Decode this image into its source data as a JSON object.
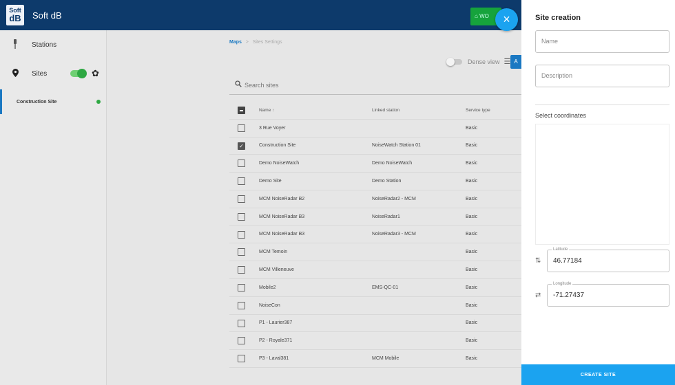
{
  "app": {
    "logo_top": "Soft",
    "logo_bottom": "dB",
    "title": "Soft dB",
    "green_button_label": "WO"
  },
  "sidebar": {
    "items": [
      {
        "label": "Stations",
        "icon": "radio-tower-icon"
      },
      {
        "label": "Sites",
        "icon": "map-pin-icon",
        "toggle_on": true
      }
    ],
    "site_list": [
      {
        "label": "Construction Site",
        "status_color": "#2ea843"
      }
    ]
  },
  "breadcrumb": {
    "root": "Maps",
    "separator": ">",
    "current": "Sites Settings"
  },
  "toolbar": {
    "dense_view_label": "Dense view",
    "dense_view_on": false
  },
  "search": {
    "placeholder": "Search sites"
  },
  "table": {
    "headers": {
      "name": "Name ↑",
      "linked_station": "Linked station",
      "service_type": "Service type"
    },
    "rows": [
      {
        "name": "3 Rue Voyer",
        "linked_station": "",
        "service_type": "Basic",
        "checked": false
      },
      {
        "name": "Construction Site",
        "linked_station": "NoiseWatch Station 01",
        "service_type": "Basic",
        "checked": true
      },
      {
        "name": "Demo NoiseWatch",
        "linked_station": "Demo NoiseWatch",
        "service_type": "Basic",
        "checked": false
      },
      {
        "name": "Demo Site",
        "linked_station": "Demo Station",
        "service_type": "Basic",
        "checked": false
      },
      {
        "name": "MCM NoiseRadar B2",
        "linked_station": "NoiseRadar2 - MCM",
        "service_type": "Basic",
        "checked": false
      },
      {
        "name": "MCM NoiseRadar B3",
        "linked_station": "NoiseRadar1",
        "service_type": "Basic",
        "checked": false
      },
      {
        "name": "MCM NoiseRadar B3",
        "linked_station": "NoiseRadar3 - MCM",
        "service_type": "Basic",
        "checked": false
      },
      {
        "name": "MCM Temoin",
        "linked_station": "",
        "service_type": "Basic",
        "checked": false
      },
      {
        "name": "MCM Villeneuve",
        "linked_station": "",
        "service_type": "Basic",
        "checked": false
      },
      {
        "name": "Mobile2",
        "linked_station": "EMS-QC-01",
        "service_type": "Basic",
        "checked": false
      },
      {
        "name": "NoiseCon",
        "linked_station": "",
        "service_type": "Basic",
        "checked": false
      },
      {
        "name": "P1 - Laurier387",
        "linked_station": "",
        "service_type": "Basic",
        "checked": false
      },
      {
        "name": "P2 - Royale371",
        "linked_station": "",
        "service_type": "Basic",
        "checked": false
      },
      {
        "name": "P3 - Laval381",
        "linked_station": "MCM Mobile",
        "service_type": "Basic",
        "checked": false
      }
    ]
  },
  "panel": {
    "title": "Site creation",
    "name_placeholder": "Name",
    "description_placeholder": "Description",
    "coords_label": "Select coordinates",
    "latitude_label": "Latitude",
    "latitude_value": "46.77184",
    "longitude_label": "Longitude",
    "longitude_value": "-71.27437",
    "create_button": "CREATE SITE"
  },
  "colors": {
    "topbar": "#0d3a6b",
    "accent": "#1ba3f0",
    "active": "#2ea843"
  }
}
